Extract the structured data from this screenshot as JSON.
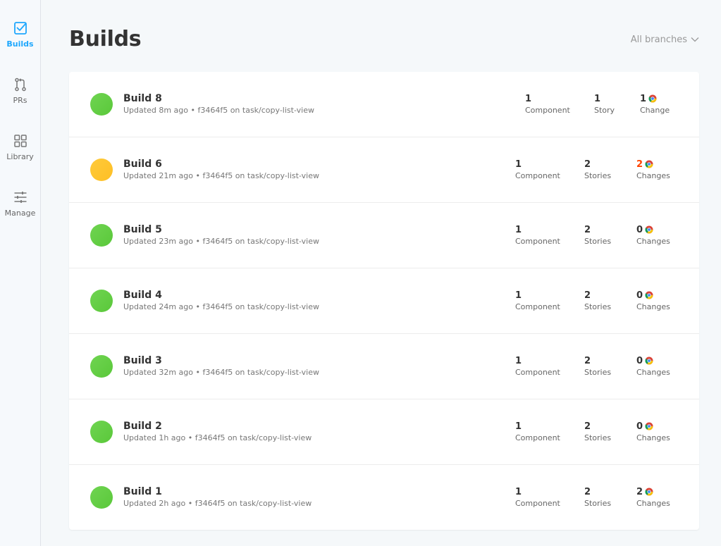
{
  "sidebar": {
    "items": [
      {
        "label": "Builds",
        "icon": "check-square-icon",
        "active": true
      },
      {
        "label": "PRs",
        "icon": "pull-request-icon",
        "active": false
      },
      {
        "label": "Library",
        "icon": "grid-icon",
        "active": false
      },
      {
        "label": "Manage",
        "icon": "sliders-icon",
        "active": false
      }
    ]
  },
  "header": {
    "title": "Builds",
    "branch_filter": "All branches",
    "branch_filter_icon": "chevron-down-icon"
  },
  "colors": {
    "accent": "#1ea7fd",
    "status_passed": "#66bf3c",
    "status_pending": "#ffc42b",
    "changes_warning": "#ff4400"
  },
  "builds": [
    {
      "name": "Build 8",
      "status": "passed",
      "meta": "Updated 8m ago • f3464f5 on task/copy-list-view",
      "components": "1",
      "components_label": "Component",
      "stories": "1",
      "stories_label": "Story",
      "changes": "1",
      "changes_label": "Change",
      "browser_icon": "chrome-icon"
    },
    {
      "name": "Build 6",
      "status": "pending",
      "meta": "Updated 21m ago • f3464f5 on task/copy-list-view",
      "components": "1",
      "components_label": "Component",
      "stories": "2",
      "stories_label": "Stories",
      "changes": "2",
      "changes_label": "Changes",
      "browser_icon": "chrome-icon"
    },
    {
      "name": "Build 5",
      "status": "passed",
      "meta": "Updated 23m ago • f3464f5 on task/copy-list-view",
      "components": "1",
      "components_label": "Component",
      "stories": "2",
      "stories_label": "Stories",
      "changes": "0",
      "changes_label": "Changes",
      "browser_icon": "chrome-icon"
    },
    {
      "name": "Build 4",
      "status": "passed",
      "meta": "Updated 24m ago • f3464f5 on task/copy-list-view",
      "components": "1",
      "components_label": "Component",
      "stories": "2",
      "stories_label": "Stories",
      "changes": "0",
      "changes_label": "Changes",
      "browser_icon": "chrome-icon"
    },
    {
      "name": "Build 3",
      "status": "passed",
      "meta": "Updated 32m ago • f3464f5 on task/copy-list-view",
      "components": "1",
      "components_label": "Component",
      "stories": "2",
      "stories_label": "Stories",
      "changes": "0",
      "changes_label": "Changes",
      "browser_icon": "chrome-icon"
    },
    {
      "name": "Build 2",
      "status": "passed",
      "meta": "Updated 1h ago • f3464f5 on task/copy-list-view",
      "components": "1",
      "components_label": "Component",
      "stories": "2",
      "stories_label": "Stories",
      "changes": "0",
      "changes_label": "Changes",
      "browser_icon": "chrome-icon"
    },
    {
      "name": "Build 1",
      "status": "passed",
      "meta": "Updated 2h ago • f3464f5 on task/copy-list-view",
      "components": "1",
      "components_label": "Component",
      "stories": "2",
      "stories_label": "Stories",
      "changes": "2",
      "changes_label": "Changes",
      "browser_icon": "chrome-icon"
    }
  ]
}
